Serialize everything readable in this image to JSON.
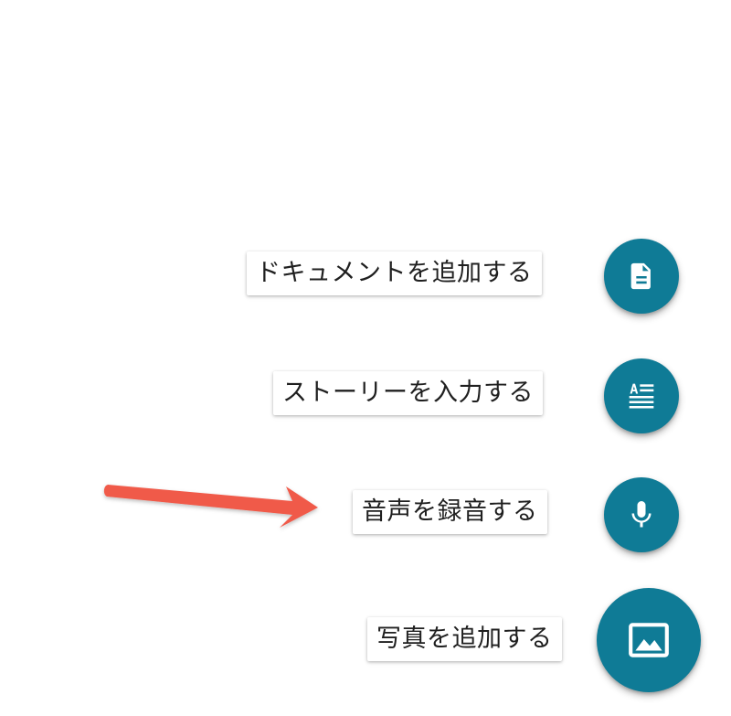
{
  "fab_menu": {
    "items": [
      {
        "label": "ドキュメントを追加する",
        "icon": "document-icon"
      },
      {
        "label": "ストーリーを入力する",
        "icon": "text-article-icon"
      },
      {
        "label": "音声を録音する",
        "icon": "microphone-icon"
      },
      {
        "label": "写真を追加する",
        "icon": "image-icon"
      }
    ]
  },
  "colors": {
    "fab": "#0f7b96",
    "annotation_arrow": "#f05a4a"
  },
  "annotation": {
    "icon": "red-arrow"
  }
}
